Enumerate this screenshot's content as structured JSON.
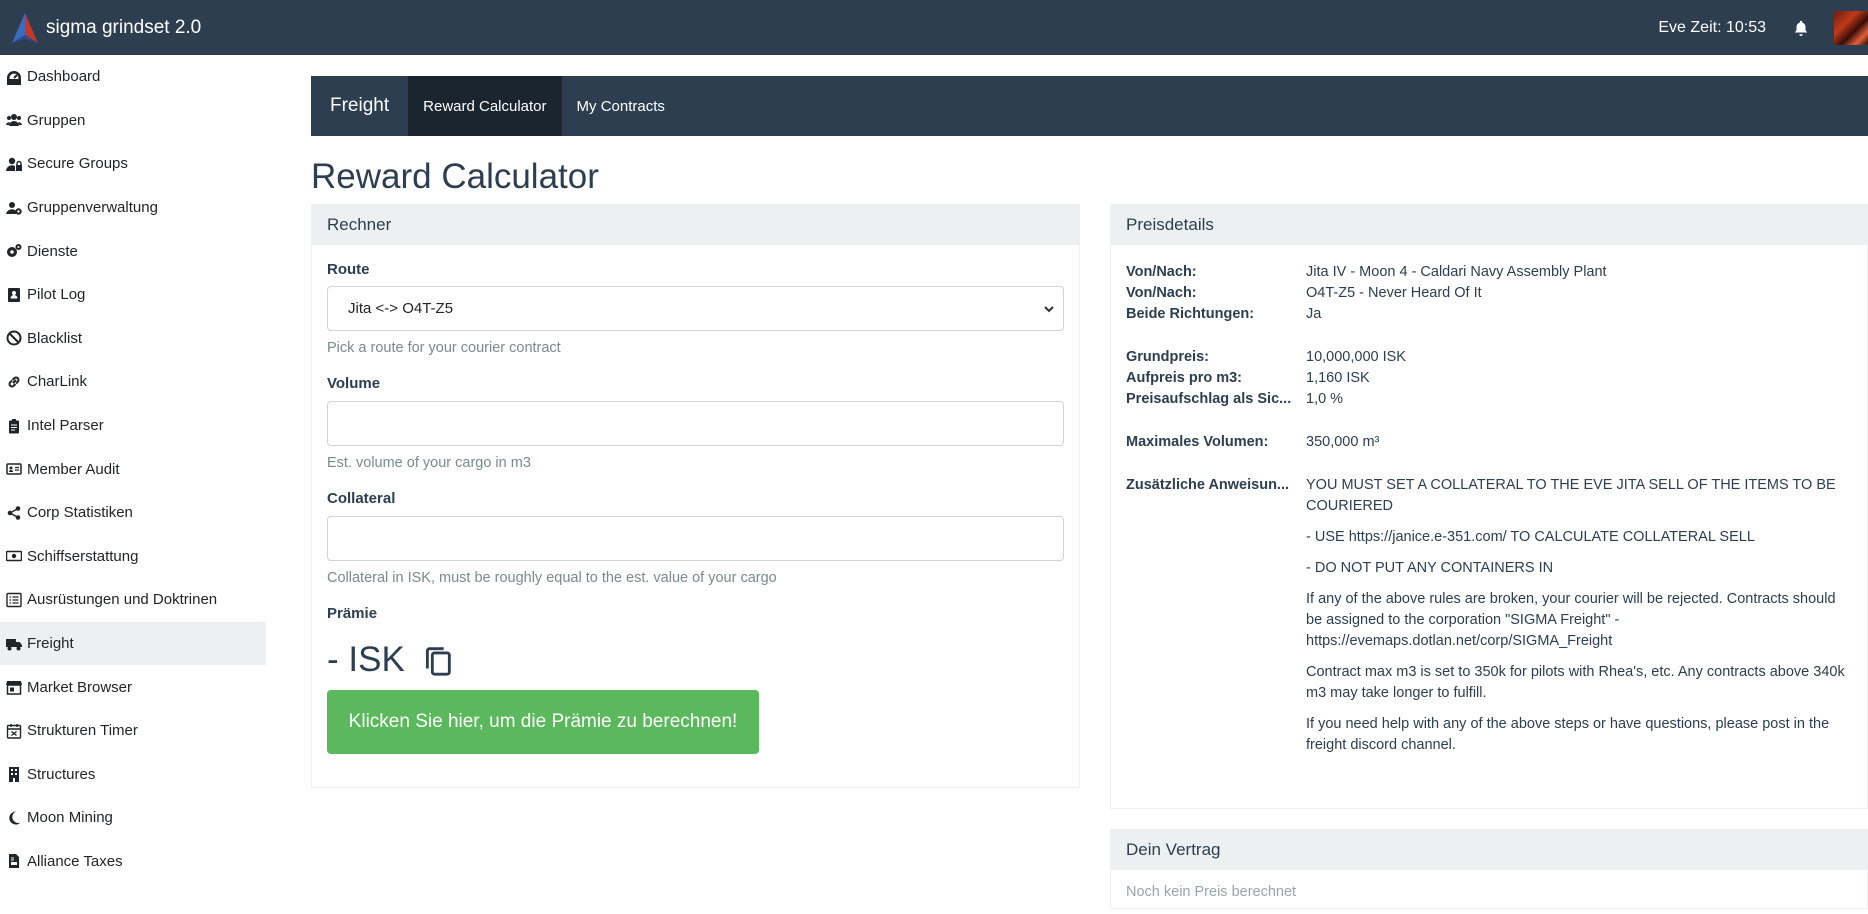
{
  "app": {
    "title": "sigma grindset 2.0",
    "eve_time": "Eve Zeit: 10:53"
  },
  "sidebar": {
    "items": [
      {
        "label": "Dashboard",
        "icon": "dashboard-icon"
      },
      {
        "label": "Gruppen",
        "icon": "users-icon"
      },
      {
        "label": "Secure Groups",
        "icon": "user-lock-icon"
      },
      {
        "label": "Gruppenverwaltung",
        "icon": "users-cog-icon"
      },
      {
        "label": "Dienste",
        "icon": "cogs-icon"
      },
      {
        "label": "Pilot Log",
        "icon": "address-book-icon"
      },
      {
        "label": "Blacklist",
        "icon": "ban-icon"
      },
      {
        "label": "CharLink",
        "icon": "link-icon"
      },
      {
        "label": "Intel Parser",
        "icon": "clipboard-icon"
      },
      {
        "label": "Member Audit",
        "icon": "id-card-icon"
      },
      {
        "label": "Corp Statistiken",
        "icon": "share-icon"
      },
      {
        "label": "Schiffserstattung",
        "icon": "money-icon"
      },
      {
        "label": "Ausrüstungen und Doktrinen",
        "icon": "list-icon"
      },
      {
        "label": "Freight",
        "icon": "truck-icon",
        "active": true
      },
      {
        "label": "Market Browser",
        "icon": "store-icon"
      },
      {
        "label": "Strukturen Timer",
        "icon": "calendar-icon"
      },
      {
        "label": "Structures",
        "icon": "building-icon"
      },
      {
        "label": "Moon Mining",
        "icon": "moon-icon"
      },
      {
        "label": "Alliance Taxes",
        "icon": "file-invoice-icon"
      }
    ]
  },
  "subnav": {
    "brand": "Freight",
    "tabs": [
      "Reward Calculator",
      "My Contracts"
    ],
    "active_tab": "Reward Calculator"
  },
  "page": {
    "title": "Reward Calculator"
  },
  "calculator": {
    "header": "Rechner",
    "route_label": "Route",
    "route_value": "Jita <-> O4T-Z5",
    "route_help": "Pick a route for your courier contract",
    "volume_label": "Volume",
    "volume_value": "",
    "volume_help": "Est. volume of your cargo in m3",
    "collateral_label": "Collateral",
    "collateral_value": "",
    "collateral_help": "Collateral in ISK, must be roughly equal to the est. value of your cargo",
    "reward_label": "Prämie",
    "reward_value": "- ISK",
    "button": "Klicken Sie hier, um die Prämie zu berechnen!",
    "button_color": "#5cb85c"
  },
  "details": {
    "header": "Preisdetails",
    "rows1": [
      {
        "k": "Von/Nach:",
        "v": "Jita IV - Moon 4 - Caldari Navy Assembly Plant"
      },
      {
        "k": "Von/Nach:",
        "v": "O4T-Z5 - Never Heard Of It"
      },
      {
        "k": "Beide Richtungen:",
        "v": "Ja"
      }
    ],
    "rows2": [
      {
        "k": "Grundpreis:",
        "v": "10,000,000  ISK"
      },
      {
        "k": "Aufpreis pro m3:",
        "v": "1,160  ISK"
      },
      {
        "k": "Preisaufschlag als Sic...",
        "v": "1,0 %"
      }
    ],
    "rows3": [
      {
        "k": "Maximales Volumen:",
        "v": "350,000  m³"
      }
    ],
    "instructions_label": "Zusätzliche Anweisun...",
    "instructions": [
      "YOU MUST SET A COLLATERAL TO THE EVE JITA SELL OF THE ITEMS TO BE COURIERED",
      "- USE https://janice.e-351.com/ TO CALCULATE COLLATERAL SELL",
      "- DO NOT PUT ANY CONTAINERS IN",
      "If any of the above rules are broken, your courier will be rejected. Contracts should be assigned to the corporation \"SIGMA Freight\" - https://evemaps.dotlan.net/corp/SIGMA_Freight",
      "Contract max m3 is set to 350k for pilots with Rhea's, etc. Any contracts above 340k m3 may take longer to fulfill.",
      "If you need help with any of the above steps or have questions, please post in the freight discord channel."
    ]
  },
  "contract": {
    "header": "Dein Vertrag",
    "text": "Noch kein Preis berechnet"
  }
}
